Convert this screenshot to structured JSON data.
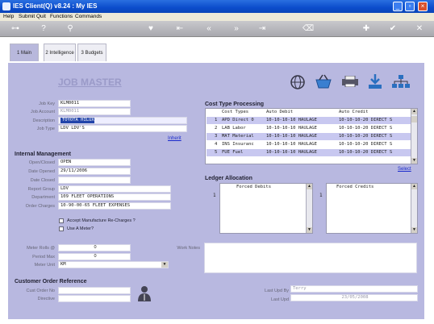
{
  "window": {
    "title": "IES Client(Q) v8.24 : My IES"
  },
  "menu": [
    "Help",
    "Submit",
    "Quit",
    "Functions",
    "Commands"
  ],
  "toolbar": {
    "icons": [
      "key-icon",
      "help-icon",
      "search-icon",
      "heart-icon",
      "first-icon",
      "prev-icon",
      "next-icon",
      "last-icon",
      "delete-icon",
      "add-icon",
      "ok-icon",
      "close-icon"
    ]
  },
  "tabs": [
    "1 Main",
    "2 Intelligence",
    "3 Budgets"
  ],
  "page_title": "JOB MASTER",
  "job": {
    "job_key_label": "Job Key",
    "job_key": "KLM0011",
    "job_account_label": "Job Account",
    "job_account": "KLM0011",
    "description_label": "Description",
    "description": "TOYOTA HILUX",
    "job_type_label": "Job Type",
    "job_type": "LDV LDV'S",
    "inherit": "Inherit"
  },
  "internal": {
    "title": "Internal Management",
    "open_closed_label": "Open/Closed",
    "open_closed": "OPEN",
    "date_opened_label": "Date Opened",
    "date_opened": "29/11/2006",
    "date_closed_label": "Date Closed",
    "date_closed": "",
    "report_group_label": "Report Group",
    "report_group": "LDV",
    "department_label": "Department",
    "department": "109 FLEET OPERATIONS",
    "order_charges_label": "Order Charges",
    "order_charges": "10-90-00-65 FLEET EXPENSES",
    "accept_recharges": "Accept Manufacture Re-Charges ?",
    "use_meter": "Use A Meter?"
  },
  "meter": {
    "rolls_label": "Meter Rolls @",
    "rolls": "0",
    "period_max_label": "Period Max",
    "period_max": "0",
    "unit_label": "Meter Unit",
    "unit": "KM",
    "work_notes_label": "Work Notes"
  },
  "cost_types": {
    "title": "Cost Type Processing",
    "columns": [
      "Cost Types",
      "Auto Debit",
      "Auto Credit"
    ],
    "rows": [
      {
        "n": "1",
        "type": "APD Direct 0",
        "debit": "10-10-10-10 HAULAGE",
        "credit": "10-10-10-20 DIRECT S"
      },
      {
        "n": "2",
        "type": "LAB Labor",
        "debit": "10-10-10-10 HAULAGE",
        "credit": "10-10-10-20 DIRECT S"
      },
      {
        "n": "3",
        "type": "MAT Material",
        "debit": "10-10-10-10 HAULAGE",
        "credit": "10-10-10-20 DIRECT S"
      },
      {
        "n": "4",
        "type": "INS Insuranc",
        "debit": "10-10-10-10 HAULAGE",
        "credit": "10-10-10-20 DIRECT S"
      },
      {
        "n": "5",
        "type": "FUE Fuel",
        "debit": "10-10-10-10 HAULAGE",
        "credit": "10-10-10-20 DIRECT S"
      }
    ],
    "select": "Select"
  },
  "ledger": {
    "title": "Ledger Allocation",
    "debits_header": "Forced Debits",
    "debits_first": "1",
    "credits_header": "Forced Credits",
    "credits_first": "1"
  },
  "customer": {
    "title": "Customer Order Reference",
    "cust_order_label": "Cust Order No",
    "cust_order": "",
    "directive_label": "Directive",
    "directive": "",
    "last_upd_by_label": "Last Upd By",
    "last_upd_by": "Terry",
    "last_upd_label": "Last Upd",
    "last_upd": "23/05/2008"
  }
}
